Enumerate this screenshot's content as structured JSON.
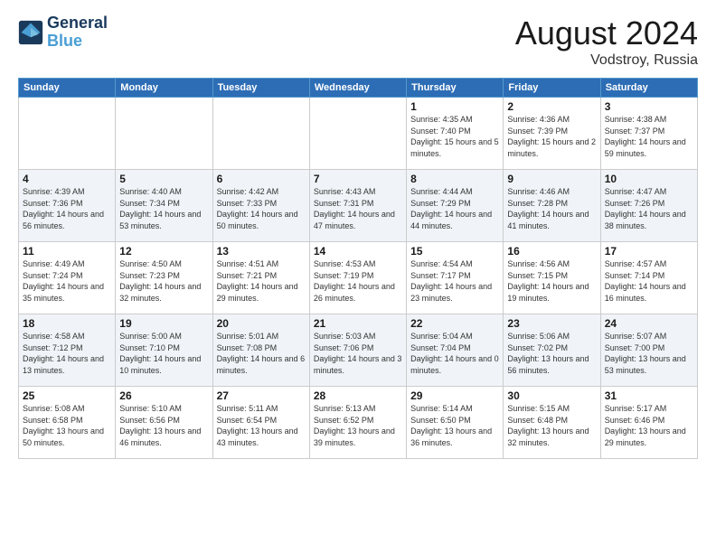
{
  "logo": {
    "line1": "General",
    "line2": "Blue"
  },
  "title": "August 2024",
  "subtitle": "Vodstroy, Russia",
  "days_header": [
    "Sunday",
    "Monday",
    "Tuesday",
    "Wednesday",
    "Thursday",
    "Friday",
    "Saturday"
  ],
  "weeks": [
    [
      {
        "day": "",
        "info": ""
      },
      {
        "day": "",
        "info": ""
      },
      {
        "day": "",
        "info": ""
      },
      {
        "day": "",
        "info": ""
      },
      {
        "day": "1",
        "info": "Sunrise: 4:35 AM\nSunset: 7:40 PM\nDaylight: 15 hours\nand 5 minutes."
      },
      {
        "day": "2",
        "info": "Sunrise: 4:36 AM\nSunset: 7:39 PM\nDaylight: 15 hours\nand 2 minutes."
      },
      {
        "day": "3",
        "info": "Sunrise: 4:38 AM\nSunset: 7:37 PM\nDaylight: 14 hours\nand 59 minutes."
      }
    ],
    [
      {
        "day": "4",
        "info": "Sunrise: 4:39 AM\nSunset: 7:36 PM\nDaylight: 14 hours\nand 56 minutes."
      },
      {
        "day": "5",
        "info": "Sunrise: 4:40 AM\nSunset: 7:34 PM\nDaylight: 14 hours\nand 53 minutes."
      },
      {
        "day": "6",
        "info": "Sunrise: 4:42 AM\nSunset: 7:33 PM\nDaylight: 14 hours\nand 50 minutes."
      },
      {
        "day": "7",
        "info": "Sunrise: 4:43 AM\nSunset: 7:31 PM\nDaylight: 14 hours\nand 47 minutes."
      },
      {
        "day": "8",
        "info": "Sunrise: 4:44 AM\nSunset: 7:29 PM\nDaylight: 14 hours\nand 44 minutes."
      },
      {
        "day": "9",
        "info": "Sunrise: 4:46 AM\nSunset: 7:28 PM\nDaylight: 14 hours\nand 41 minutes."
      },
      {
        "day": "10",
        "info": "Sunrise: 4:47 AM\nSunset: 7:26 PM\nDaylight: 14 hours\nand 38 minutes."
      }
    ],
    [
      {
        "day": "11",
        "info": "Sunrise: 4:49 AM\nSunset: 7:24 PM\nDaylight: 14 hours\nand 35 minutes."
      },
      {
        "day": "12",
        "info": "Sunrise: 4:50 AM\nSunset: 7:23 PM\nDaylight: 14 hours\nand 32 minutes."
      },
      {
        "day": "13",
        "info": "Sunrise: 4:51 AM\nSunset: 7:21 PM\nDaylight: 14 hours\nand 29 minutes."
      },
      {
        "day": "14",
        "info": "Sunrise: 4:53 AM\nSunset: 7:19 PM\nDaylight: 14 hours\nand 26 minutes."
      },
      {
        "day": "15",
        "info": "Sunrise: 4:54 AM\nSunset: 7:17 PM\nDaylight: 14 hours\nand 23 minutes."
      },
      {
        "day": "16",
        "info": "Sunrise: 4:56 AM\nSunset: 7:15 PM\nDaylight: 14 hours\nand 19 minutes."
      },
      {
        "day": "17",
        "info": "Sunrise: 4:57 AM\nSunset: 7:14 PM\nDaylight: 14 hours\nand 16 minutes."
      }
    ],
    [
      {
        "day": "18",
        "info": "Sunrise: 4:58 AM\nSunset: 7:12 PM\nDaylight: 14 hours\nand 13 minutes."
      },
      {
        "day": "19",
        "info": "Sunrise: 5:00 AM\nSunset: 7:10 PM\nDaylight: 14 hours\nand 10 minutes."
      },
      {
        "day": "20",
        "info": "Sunrise: 5:01 AM\nSunset: 7:08 PM\nDaylight: 14 hours\nand 6 minutes."
      },
      {
        "day": "21",
        "info": "Sunrise: 5:03 AM\nSunset: 7:06 PM\nDaylight: 14 hours\nand 3 minutes."
      },
      {
        "day": "22",
        "info": "Sunrise: 5:04 AM\nSunset: 7:04 PM\nDaylight: 14 hours\nand 0 minutes."
      },
      {
        "day": "23",
        "info": "Sunrise: 5:06 AM\nSunset: 7:02 PM\nDaylight: 13 hours\nand 56 minutes."
      },
      {
        "day": "24",
        "info": "Sunrise: 5:07 AM\nSunset: 7:00 PM\nDaylight: 13 hours\nand 53 minutes."
      }
    ],
    [
      {
        "day": "25",
        "info": "Sunrise: 5:08 AM\nSunset: 6:58 PM\nDaylight: 13 hours\nand 50 minutes."
      },
      {
        "day": "26",
        "info": "Sunrise: 5:10 AM\nSunset: 6:56 PM\nDaylight: 13 hours\nand 46 minutes."
      },
      {
        "day": "27",
        "info": "Sunrise: 5:11 AM\nSunset: 6:54 PM\nDaylight: 13 hours\nand 43 minutes."
      },
      {
        "day": "28",
        "info": "Sunrise: 5:13 AM\nSunset: 6:52 PM\nDaylight: 13 hours\nand 39 minutes."
      },
      {
        "day": "29",
        "info": "Sunrise: 5:14 AM\nSunset: 6:50 PM\nDaylight: 13 hours\nand 36 minutes."
      },
      {
        "day": "30",
        "info": "Sunrise: 5:15 AM\nSunset: 6:48 PM\nDaylight: 13 hours\nand 32 minutes."
      },
      {
        "day": "31",
        "info": "Sunrise: 5:17 AM\nSunset: 6:46 PM\nDaylight: 13 hours\nand 29 minutes."
      }
    ]
  ]
}
